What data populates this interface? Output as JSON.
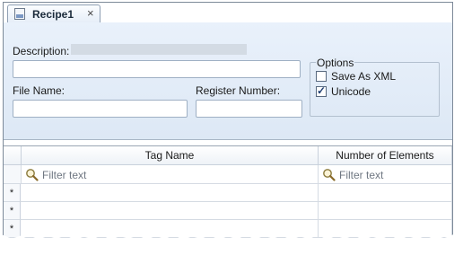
{
  "tab": {
    "title": "Recipe1",
    "close": "×",
    "icon": "xml-document-icon"
  },
  "form": {
    "description_label": "Description:",
    "description_value": "",
    "file_name_label": "File Name:",
    "file_name_value": "",
    "register_number_label": "Register Number:",
    "register_number_value": "",
    "options": {
      "title": "Options",
      "save_as_xml_label": "Save As XML",
      "save_as_xml_checked": false,
      "unicode_label": "Unicode",
      "unicode_checked": true
    }
  },
  "grid": {
    "columns": [
      "Tag Name",
      "Number of Elements"
    ],
    "filter_placeholder": "Filter text",
    "rows": [
      {
        "marker": "*"
      },
      {
        "marker": "*"
      },
      {
        "marker": "*"
      }
    ]
  },
  "colors": {
    "form_background": "#e4edf8",
    "border": "#9aa6b4",
    "checkbox_check": "#1f3e72"
  }
}
